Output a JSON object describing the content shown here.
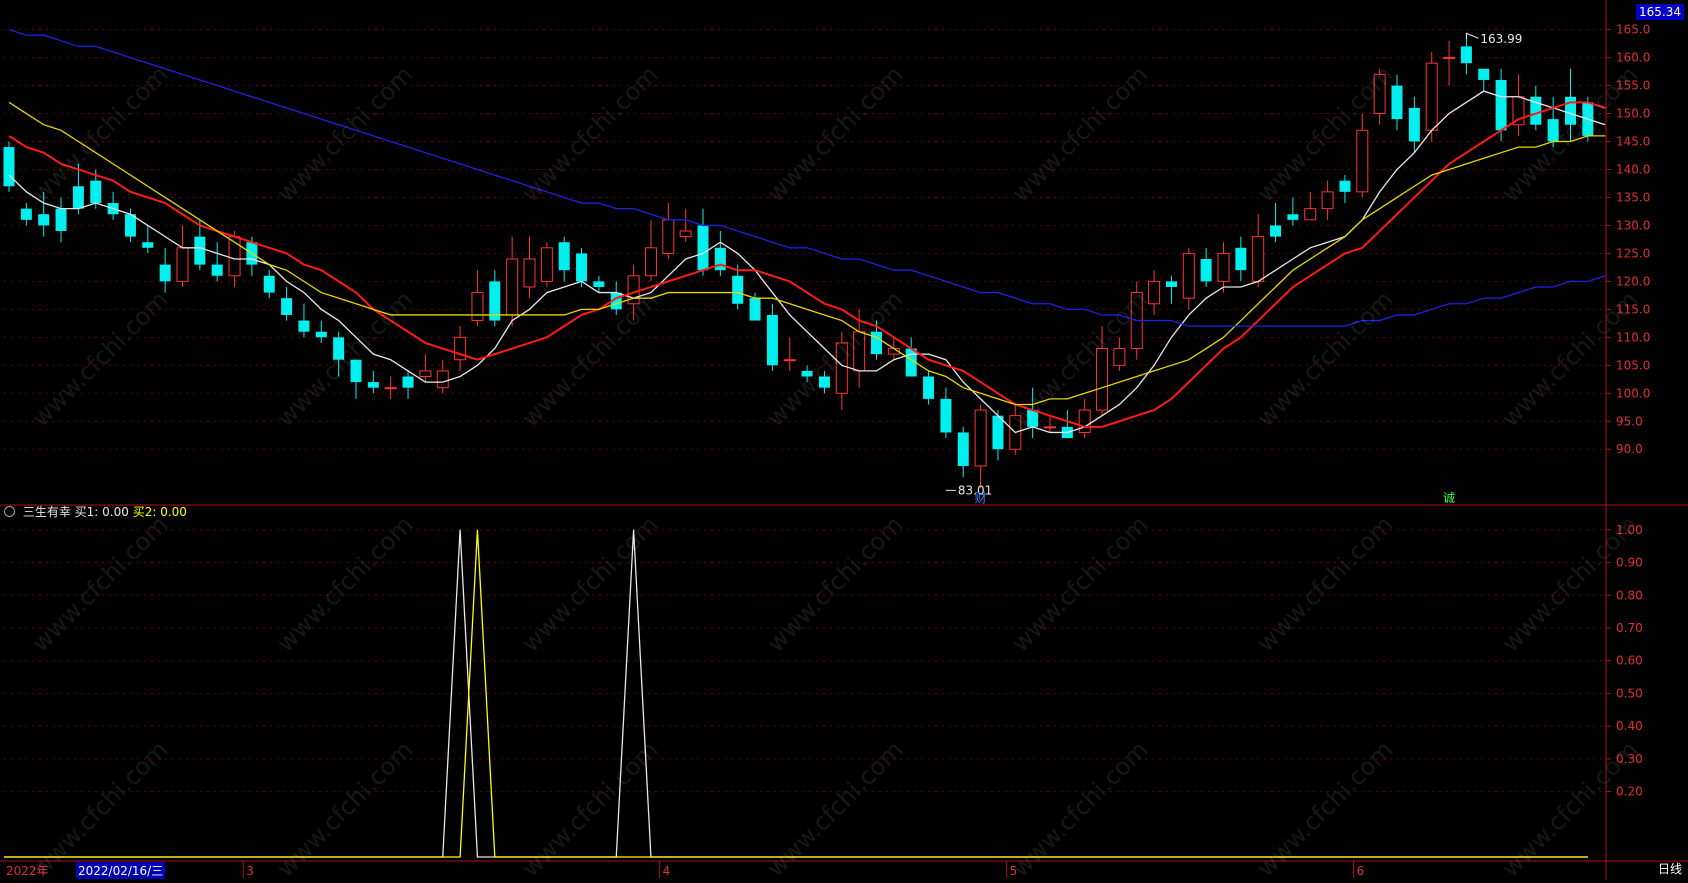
{
  "watermark": "www.cfchi.com",
  "price_flag": "165.34",
  "indicator": {
    "name": "三生有幸",
    "buy1_label": "买1: 0.00",
    "buy2_label": "买2: 0.00"
  },
  "bottom_bar": {
    "year_label": "2022年",
    "cursor_date": "2022/02/16/三",
    "period": "日线"
  },
  "chart_data": [
    {
      "type": "candlestick",
      "y_axis": {
        "ticks": [
          90,
          95,
          100,
          105,
          110,
          115,
          120,
          125,
          130,
          135,
          140,
          145,
          150,
          155,
          160,
          165
        ],
        "ylim": [
          82,
          166
        ]
      },
      "month_labels": [
        {
          "label": "3",
          "index": 14
        },
        {
          "label": "4",
          "index": 38
        },
        {
          "label": "5",
          "index": 58
        },
        {
          "label": "6",
          "index": 78
        }
      ],
      "annotations": {
        "high": {
          "text": "163.99",
          "index": 84,
          "value": 163.99
        },
        "low": {
          "text": "83.01",
          "index": 54,
          "value": 83.01
        },
        "markers": [
          {
            "text": "财",
            "index": 56
          },
          {
            "text": "诚",
            "index": 83
          }
        ]
      },
      "candles": [
        [
          144,
          137,
          145,
          136
        ],
        [
          133,
          131,
          134,
          130
        ],
        [
          132,
          130,
          136,
          128
        ],
        [
          133,
          129,
          135,
          127
        ],
        [
          137,
          133,
          141,
          132
        ],
        [
          138,
          134,
          140,
          133
        ],
        [
          134,
          132,
          136,
          131
        ],
        [
          132,
          128,
          133,
          127
        ],
        [
          127,
          126,
          130,
          125
        ],
        [
          123,
          120,
          126,
          118
        ],
        [
          120,
          126,
          130,
          119
        ],
        [
          128,
          123,
          131,
          122
        ],
        [
          123,
          121,
          127,
          120
        ],
        [
          121,
          128,
          129,
          119
        ],
        [
          127,
          123,
          128,
          121
        ],
        [
          121,
          118,
          122,
          117
        ],
        [
          117,
          114,
          119,
          113
        ],
        [
          113,
          111,
          116,
          110
        ],
        [
          111,
          110,
          113,
          109
        ],
        [
          110,
          106,
          111,
          103
        ],
        [
          106,
          102,
          106,
          99
        ],
        [
          102,
          101,
          104,
          100
        ],
        [
          101,
          101,
          103,
          99
        ],
        [
          103,
          101,
          104,
          99
        ],
        [
          103,
          104,
          107,
          102
        ],
        [
          101,
          104,
          106,
          100
        ],
        [
          106,
          110,
          112,
          104
        ],
        [
          113,
          118,
          122,
          112
        ],
        [
          120,
          113,
          122,
          112
        ],
        [
          114,
          124,
          128,
          112
        ],
        [
          119,
          124,
          128,
          117
        ],
        [
          120,
          126,
          127,
          119
        ],
        [
          127,
          122,
          128,
          120
        ],
        [
          125,
          120,
          126,
          119
        ],
        [
          120,
          119,
          121,
          118
        ],
        [
          118,
          115,
          120,
          114
        ],
        [
          116,
          121,
          123,
          113
        ],
        [
          121,
          126,
          131,
          120
        ],
        [
          125,
          131,
          134,
          124
        ],
        [
          128,
          129,
          133,
          127
        ],
        [
          130,
          122,
          133,
          121
        ],
        [
          126,
          122,
          129,
          121
        ],
        [
          121,
          116,
          123,
          115
        ],
        [
          117,
          113,
          118,
          113
        ],
        [
          114,
          105,
          116,
          104
        ],
        [
          106,
          106,
          110,
          104
        ],
        [
          104,
          103,
          105,
          102
        ],
        [
          103,
          101,
          104,
          100
        ],
        [
          100,
          109,
          111,
          97
        ],
        [
          104,
          111,
          115,
          101
        ],
        [
          111,
          107,
          113,
          106
        ],
        [
          107,
          108,
          110,
          106
        ],
        [
          108,
          103,
          110,
          103
        ],
        [
          103,
          99,
          104,
          98
        ],
        [
          99,
          93,
          101,
          92
        ],
        [
          93,
          87,
          94,
          85
        ],
        [
          87,
          97,
          98,
          83
        ],
        [
          96,
          90,
          97,
          88
        ],
        [
          90,
          96,
          98,
          89
        ],
        [
          97,
          94,
          101,
          92
        ],
        [
          94,
          94,
          96,
          93
        ],
        [
          94,
          92,
          97,
          92
        ],
        [
          93,
          97,
          99,
          92
        ],
        [
          97,
          108,
          112,
          96
        ],
        [
          105,
          108,
          110,
          104
        ],
        [
          108,
          118,
          120,
          106
        ],
        [
          116,
          120,
          122,
          114
        ],
        [
          120,
          119,
          121,
          116
        ],
        [
          117,
          125,
          126,
          115
        ],
        [
          124,
          120,
          126,
          119
        ],
        [
          120,
          125,
          127,
          118
        ],
        [
          126,
          122,
          128,
          120
        ],
        [
          120,
          128,
          132,
          119
        ],
        [
          130,
          128,
          134,
          127
        ],
        [
          132,
          131,
          135,
          130
        ],
        [
          131,
          133,
          136,
          131
        ],
        [
          133,
          136,
          138,
          131
        ],
        [
          138,
          136,
          139,
          134
        ],
        [
          136,
          147,
          150,
          135
        ],
        [
          150,
          157,
          158,
          148
        ],
        [
          155,
          149,
          157,
          147
        ],
        [
          151,
          145,
          153,
          143
        ],
        [
          147,
          159,
          161,
          145
        ],
        [
          160,
          160,
          163,
          155
        ],
        [
          162,
          159,
          164,
          157
        ],
        [
          158,
          156,
          158,
          154
        ],
        [
          156,
          147,
          158,
          145
        ],
        [
          148,
          153,
          157,
          146
        ],
        [
          153,
          148,
          155,
          147
        ],
        [
          149,
          145,
          153,
          144
        ],
        [
          153,
          148,
          158,
          145
        ],
        [
          152,
          146,
          153,
          145
        ]
      ],
      "series": [
        {
          "name": "MA5",
          "color": "#e8e8e8",
          "values": [
            139,
            136,
            134,
            133,
            133,
            134,
            133,
            132,
            130,
            128,
            126,
            126,
            125,
            124,
            124,
            123,
            120,
            118,
            115,
            113,
            110,
            107,
            106,
            104,
            102,
            102,
            103,
            105,
            108,
            113,
            115,
            118,
            119,
            120,
            118,
            118,
            117,
            118,
            121,
            124,
            125,
            127,
            125,
            122,
            118,
            114,
            111,
            108,
            105,
            104,
            104,
            106,
            107,
            107,
            106,
            102,
            99,
            96,
            93,
            94,
            93,
            93,
            94,
            96,
            98,
            101,
            105,
            110,
            114,
            117,
            119,
            119,
            120,
            122,
            124,
            126,
            127,
            128,
            131,
            136,
            140,
            143,
            147,
            150,
            152,
            154,
            153,
            153,
            152,
            151,
            150,
            149,
            148
          ]
        },
        {
          "name": "MA10",
          "color": "#ff1a1a",
          "values": [
            146,
            144,
            143,
            141,
            140,
            139,
            138,
            136,
            135,
            134,
            132,
            130,
            129,
            128,
            127,
            126,
            125,
            123,
            122,
            120,
            118,
            115,
            113,
            111,
            109,
            108,
            107,
            106,
            107,
            108,
            109,
            110,
            112,
            114,
            115,
            117,
            118,
            119,
            120,
            121,
            122,
            123,
            122,
            122,
            121,
            120,
            118,
            116,
            115,
            113,
            112,
            110,
            108,
            106,
            105,
            104,
            102,
            100,
            98,
            97,
            96,
            95,
            94,
            94,
            95,
            96,
            97,
            99,
            102,
            105,
            108,
            110,
            113,
            116,
            119,
            121,
            123,
            125,
            126,
            129,
            132,
            135,
            138,
            141,
            143,
            145,
            147,
            149,
            150,
            151,
            152,
            152,
            151
          ]
        },
        {
          "name": "MA20",
          "color": "#e5d800",
          "values": [
            152,
            150,
            148,
            147,
            145,
            143,
            141,
            139,
            137,
            135,
            133,
            131,
            129,
            127,
            125,
            123,
            122,
            120,
            118,
            117,
            116,
            115,
            114,
            114,
            114,
            114,
            114,
            114,
            114,
            114,
            114,
            114,
            114,
            115,
            115,
            116,
            117,
            117,
            118,
            118,
            118,
            118,
            118,
            117,
            117,
            116,
            115,
            114,
            113,
            111,
            110,
            108,
            106,
            104,
            103,
            101,
            100,
            99,
            98,
            98,
            99,
            99,
            100,
            101,
            102,
            103,
            104,
            105,
            106,
            108,
            110,
            113,
            116,
            119,
            122,
            124,
            126,
            128,
            131,
            133,
            135,
            137,
            139,
            140,
            141,
            142,
            143,
            144,
            144,
            145,
            145,
            146,
            146
          ]
        },
        {
          "name": "MA60",
          "color": "#2020e0",
          "values": [
            165,
            164,
            164,
            163,
            162,
            162,
            161,
            160,
            159,
            158,
            157,
            156,
            155,
            154,
            153,
            152,
            151,
            150,
            149,
            148,
            147,
            146,
            145,
            144,
            143,
            142,
            141,
            140,
            139,
            138,
            137,
            136,
            135,
            134,
            134,
            133,
            133,
            132,
            131,
            131,
            130,
            130,
            129,
            128,
            127,
            126,
            126,
            125,
            124,
            124,
            123,
            122,
            122,
            121,
            120,
            119,
            118,
            118,
            117,
            116,
            116,
            115,
            115,
            114,
            114,
            113,
            113,
            113,
            112,
            112,
            112,
            112,
            112,
            112,
            112,
            112,
            112,
            112,
            113,
            113,
            114,
            114,
            115,
            116,
            116,
            117,
            117,
            118,
            119,
            119,
            120,
            120,
            121
          ]
        }
      ]
    },
    {
      "type": "line",
      "name": "三生有幸",
      "y_axis": {
        "ticks": [
          0.2,
          0.3,
          0.4,
          0.5,
          0.6,
          0.7,
          0.8,
          0.9,
          1.0
        ],
        "ylim": [
          0,
          1.03
        ]
      },
      "series": [
        {
          "name": "买1",
          "color": "#e8e8e8",
          "points": [
            [
              26,
              1
            ],
            [
              36,
              1
            ]
          ]
        },
        {
          "name": "买2",
          "color": "#ffff00",
          "points": [
            [
              27,
              1
            ]
          ]
        }
      ],
      "x_count": 92
    }
  ]
}
